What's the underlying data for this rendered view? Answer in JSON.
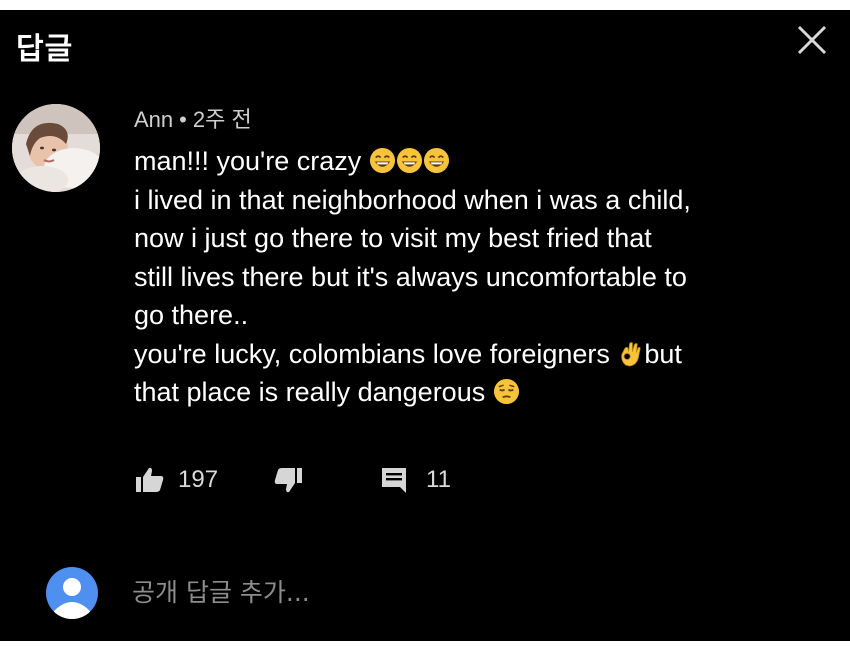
{
  "header": {
    "title": "답글"
  },
  "comment": {
    "author": "Ann",
    "separator": "•",
    "time": "2주 전",
    "line1": "man!!! you're crazy ",
    "line2": "i lived in that neighborhood when i was a child,",
    "line3": "now i just go there to visit my best fried that",
    "line4": "still lives there but it's always uncomfortable to",
    "line5": "go there..",
    "line6a": "you're lucky, colombians love foreigners ",
    "line6b": "but",
    "line7": "that place is really dangerous ",
    "emojis": [
      "grinning-sweat-emoji",
      "grinning-sweat-emoji",
      "grinning-sweat-emoji",
      "ok-hand-emoji",
      "pensive-emoji"
    ]
  },
  "actions": {
    "like_count": "197",
    "reply_count": "11"
  },
  "reply_box": {
    "placeholder": "공개 답글 추가..."
  },
  "colors": {
    "background": "#000000",
    "text": "#ffffff",
    "meta": "#cfcfcf",
    "placeholder": "#8d8d8d",
    "avatar_default": "#4f8ff0",
    "emoji_yellow": "#f7c33b"
  }
}
